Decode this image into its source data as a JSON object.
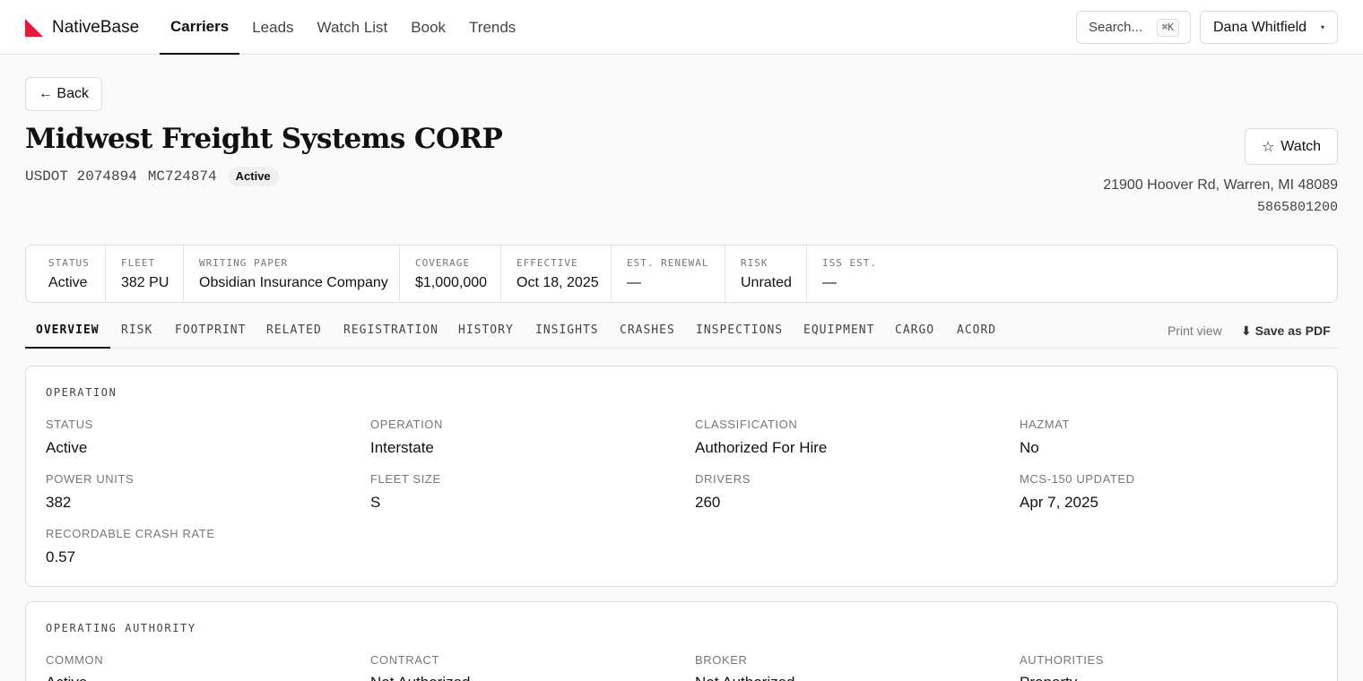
{
  "header": {
    "brand": "NativeBase",
    "nav": [
      "Carriers",
      "Leads",
      "Watch List",
      "Book",
      "Trends"
    ],
    "active_nav": "Carriers",
    "search_placeholder": "Search...",
    "search_shortcut": "⌘K",
    "user_name": "Dana Whitfield",
    "user_caret": "▾"
  },
  "page": {
    "back_label": "← Back",
    "company_name": "Midwest Freight Systems CORP",
    "usdot": "USDOT 2074894",
    "mc": "MC724874",
    "status_badge": "Active",
    "watch_label": "Watch",
    "watch_icon": "☆",
    "address": "21900 Hoover Rd, Warren, MI 48089",
    "phone": "5865801200"
  },
  "summary": [
    {
      "label": "STATUS",
      "value": "Active"
    },
    {
      "label": "FLEET",
      "value": "382 PU"
    },
    {
      "label": "WRITING PAPER",
      "value": "Obsidian Insurance Company"
    },
    {
      "label": "COVERAGE",
      "value": "$1,000,000"
    },
    {
      "label": "EFFECTIVE",
      "value": "Oct 18, 2025"
    },
    {
      "label": "EST. RENEWAL",
      "value": "—"
    },
    {
      "label": "RISK",
      "value": "Unrated"
    },
    {
      "label": "ISS EST.",
      "value": "—"
    }
  ],
  "tabs": [
    "OVERVIEW",
    "RISK",
    "FOOTPRINT",
    "RELATED",
    "REGISTRATION",
    "HISTORY",
    "INSIGHTS",
    "CRASHES",
    "INSPECTIONS",
    "EQUIPMENT",
    "CARGO",
    "ACORD"
  ],
  "active_tab": "OVERVIEW",
  "actions": {
    "print_view": "Print view",
    "save_pdf": "⬇ Save as PDF"
  },
  "operation": {
    "title": "OPERATION",
    "fields": [
      {
        "label": "STATUS",
        "value": "Active"
      },
      {
        "label": "OPERATION",
        "value": "Interstate"
      },
      {
        "label": "CLASSIFICATION",
        "value": "Authorized For Hire"
      },
      {
        "label": "HAZMAT",
        "value": "No"
      },
      {
        "label": "POWER UNITS",
        "value": "382"
      },
      {
        "label": "FLEET SIZE",
        "value": "S"
      },
      {
        "label": "DRIVERS",
        "value": "260"
      },
      {
        "label": "MCS-150 UPDATED",
        "value": "Apr 7, 2025"
      },
      {
        "label": "RECORDABLE CRASH RATE",
        "value": "0.57"
      }
    ]
  },
  "operating_authority": {
    "title": "OPERATING AUTHORITY",
    "fields": [
      {
        "label": "COMMON",
        "value": "Active"
      },
      {
        "label": "CONTRACT",
        "value": "Not Authorized"
      },
      {
        "label": "BROKER",
        "value": "Not Authorized"
      },
      {
        "label": "AUTHORITIES",
        "value": "Property"
      }
    ]
  },
  "colors": {
    "brand_red": "#e8173c",
    "text": "#111111",
    "muted": "#777777",
    "border": "#dcdcdc"
  }
}
